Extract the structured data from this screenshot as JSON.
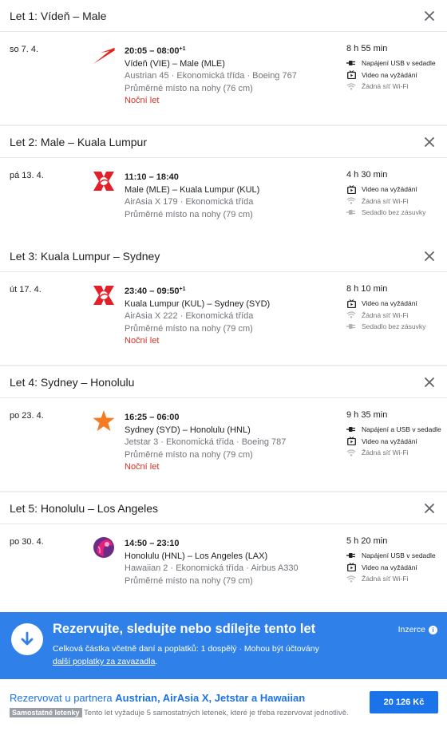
{
  "legs": [
    {
      "title": "Let 1: Vídeň – Male",
      "date": "so 7. 4.",
      "logo_icon": "austrian-airlines-logo-icon",
      "times": "20:05 – 08:00",
      "times_sup": "+1",
      "route": "Vídeň (VIE) – Male (MLE)",
      "details": "Austrian 45 · Ekonomická třída · Boeing 767",
      "legroom": "Průměrné místo na nohy (76 cm)",
      "night": "Noční let",
      "duration": "8 h 55 min",
      "amenities": [
        {
          "icon": "power-plug-icon",
          "label": "Napájení USB v sedadle",
          "muted": false
        },
        {
          "icon": "video-on-demand-icon",
          "label": "Video na vyžádání",
          "muted": false
        },
        {
          "icon": "no-wifi-icon",
          "label": "Žádná síť Wi-Fi",
          "muted": true
        }
      ]
    },
    {
      "title": "Let 2: Male – Kuala Lumpur",
      "date": "pá 13. 4.",
      "logo_icon": "airasia-x-logo-icon",
      "times": "11:10 – 18:40",
      "times_sup": "",
      "route": "Male (MLE) – Kuala Lumpur (KUL)",
      "details": "AirAsia X 179 · Ekonomická třída",
      "legroom": "Průměrné místo na nohy (79 cm)",
      "night": "",
      "duration": "4 h 30 min",
      "amenities": [
        {
          "icon": "video-on-demand-icon",
          "label": "Video na vyžádání",
          "muted": false
        },
        {
          "icon": "no-wifi-icon",
          "label": "Žádná síť Wi-Fi",
          "muted": true
        },
        {
          "icon": "no-power-outlet-icon",
          "label": "Sedadlo bez zásuvky",
          "muted": true
        }
      ]
    },
    {
      "title": "Let 3: Kuala Lumpur – Sydney",
      "date": "út 17. 4.",
      "logo_icon": "airasia-x-logo-icon",
      "times": "23:40 – 09:50",
      "times_sup": "+1",
      "route": "Kuala Lumpur (KUL) – Sydney (SYD)",
      "details": "AirAsia X 222 · Ekonomická třída",
      "legroom": "Průměrné místo na nohy (79 cm)",
      "night": "Noční let",
      "duration": "8 h 10 min",
      "amenities": [
        {
          "icon": "video-on-demand-icon",
          "label": "Video na vyžádání",
          "muted": false
        },
        {
          "icon": "no-wifi-icon",
          "label": "Žádná síť Wi-Fi",
          "muted": true
        },
        {
          "icon": "no-power-outlet-icon",
          "label": "Sedadlo bez zásuvky",
          "muted": true
        }
      ]
    },
    {
      "title": "Let 4: Sydney – Honolulu",
      "date": "po 23. 4.",
      "logo_icon": "jetstar-star-logo-icon",
      "times": "16:25 – 06:00",
      "times_sup": "",
      "route": "Sydney (SYD) – Honolulu (HNL)",
      "details": "Jetstar 3 · Ekonomická třída · Boeing 787",
      "legroom": "Průměrné místo na nohy (79 cm)",
      "night": "Noční let",
      "duration": "9 h 35 min",
      "amenities": [
        {
          "icon": "power-plug-icon",
          "label": "Napájení a USB v sedadle",
          "muted": false
        },
        {
          "icon": "video-on-demand-icon",
          "label": "Video na vyžádání",
          "muted": false
        },
        {
          "icon": "no-wifi-icon",
          "label": "Žádná síť Wi-Fi",
          "muted": true
        }
      ]
    },
    {
      "title": "Let 5: Honolulu – Los Angeles",
      "date": "po 30. 4.",
      "logo_icon": "hawaiian-airlines-logo-icon",
      "times": "14:50 – 23:10",
      "times_sup": "",
      "route": "Honolulu (HNL) – Los Angeles (LAX)",
      "details": "Hawaiian 2 · Ekonomická třída · Airbus A330",
      "legroom": "Průměrné místo na nohy (79 cm)",
      "night": "",
      "duration": "5 h 20 min",
      "amenities": [
        {
          "icon": "power-plug-icon",
          "label": "Napájení USB v sedadle",
          "muted": false
        },
        {
          "icon": "video-on-demand-icon",
          "label": "Video na vyžádání",
          "muted": false
        },
        {
          "icon": "no-wifi-icon",
          "label": "Žádná síť Wi-Fi",
          "muted": true
        }
      ]
    }
  ],
  "promo": {
    "icon": "download-arrow-icon",
    "title": "Rezervujte, sledujte nebo sdílejte tento let",
    "subtitle": "Celková částka včetně daní a poplatků: 1 dospělý · Mohou být účtovány",
    "link": "další poplatky za zavazadla",
    "link_suffix": ".",
    "ad_label": "Inzerce",
    "ad_info_icon": "info-icon",
    "ad_info_glyph": "i"
  },
  "booking": {
    "title_prefix": "Rezervovat u partnera ",
    "partners": "Austrian, AirAsia X, Jetstar a Hawaiian",
    "badge": "Samostatné letenky",
    "note": " Tento let vyžaduje 5 samostatných letenek, které je třeba rezervovat jednotlivě.",
    "price": "20 126 Kč"
  },
  "colors": {
    "promo_bg": "#2f80e8",
    "link_blue": "#1a73e8",
    "night_red": "#d93025",
    "muted_gray": "#70757a"
  }
}
